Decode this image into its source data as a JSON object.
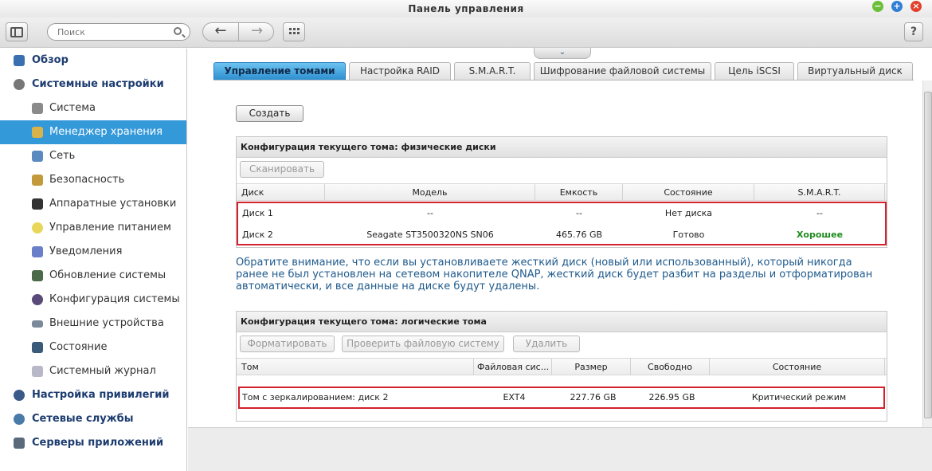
{
  "window": {
    "title": "Панель управления"
  },
  "toolbar": {
    "search_placeholder": "Поиск",
    "back_label": "←",
    "forward_label": "→",
    "help_label": "?"
  },
  "sidebar": {
    "overview": "Обзор",
    "system_settings": "Системные настройки",
    "sub_items": [
      {
        "label": "Система",
        "icon": "system-icon"
      },
      {
        "label": "Менеджер хранения",
        "icon": "storage-icon"
      },
      {
        "label": "Сеть",
        "icon": "network-icon"
      },
      {
        "label": "Безопасность",
        "icon": "lock-icon"
      },
      {
        "label": "Аппаратные установки",
        "icon": "hardware-icon"
      },
      {
        "label": "Управление питанием",
        "icon": "bulb-icon"
      },
      {
        "label": "Уведомления",
        "icon": "notification-icon"
      },
      {
        "label": "Обновление системы",
        "icon": "update-icon"
      },
      {
        "label": "Конфигурация системы",
        "icon": "config-icon"
      },
      {
        "label": "Внешние устройства",
        "icon": "external-device-icon"
      },
      {
        "label": "Состояние",
        "icon": "monitor-icon"
      },
      {
        "label": "Системный журнал",
        "icon": "log-icon"
      }
    ],
    "privileges": "Настройка привилегий",
    "network_services": "Сетевые службы",
    "app_servers": "Серверы приложений"
  },
  "tabs": [
    "Управление томами",
    "Настройка RAID",
    "S.M.A.R.T.",
    "Шифрование файловой системы",
    "Цель iSCSI",
    "Виртуальный диск"
  ],
  "main": {
    "create_label": "Создать",
    "physical_panel": {
      "title": "Конфигурация текущего тома: физические диски",
      "scan_label": "Сканировать",
      "columns": [
        "Диск",
        "Модель",
        "Емкость",
        "Состояние",
        "S.M.A.R.T."
      ],
      "rows": [
        [
          "Диск 1",
          "--",
          "--",
          "Нет диска",
          "--"
        ],
        [
          "Диск 2",
          "Seagate ST3500320NS SN06",
          "465.76 GB",
          "Готово",
          "Хорошее"
        ]
      ]
    },
    "note": "Обратите внимание, что если вы установливаете жесткий диск (новый или использованный), который никогда ранее не был установлен на сетевом накопителе QNAP, жесткий диск будет разбит на разделы и отформатирован автоматически, и все данные на диске будут удалены.",
    "logical_panel": {
      "title": "Конфигурация текущего тома: логические тома",
      "format_label": "Форматировать",
      "check_fs_label": "Проверить файловую систему",
      "delete_label": "Удалить",
      "columns": [
        "Том",
        "Файловая сис...",
        "Размер",
        "Свободно",
        "Состояние"
      ],
      "rows": [
        [
          "Том с зеркалированием: диск 2",
          "EXT4",
          "227.76 GB",
          "226.95 GB",
          "Критический режим"
        ]
      ]
    }
  },
  "colors": {
    "active_sidebar": "#3499d9",
    "highlight_border": "#d3212d",
    "smart_good": "#1e8a1e",
    "note_text": "#1f5a8c"
  }
}
